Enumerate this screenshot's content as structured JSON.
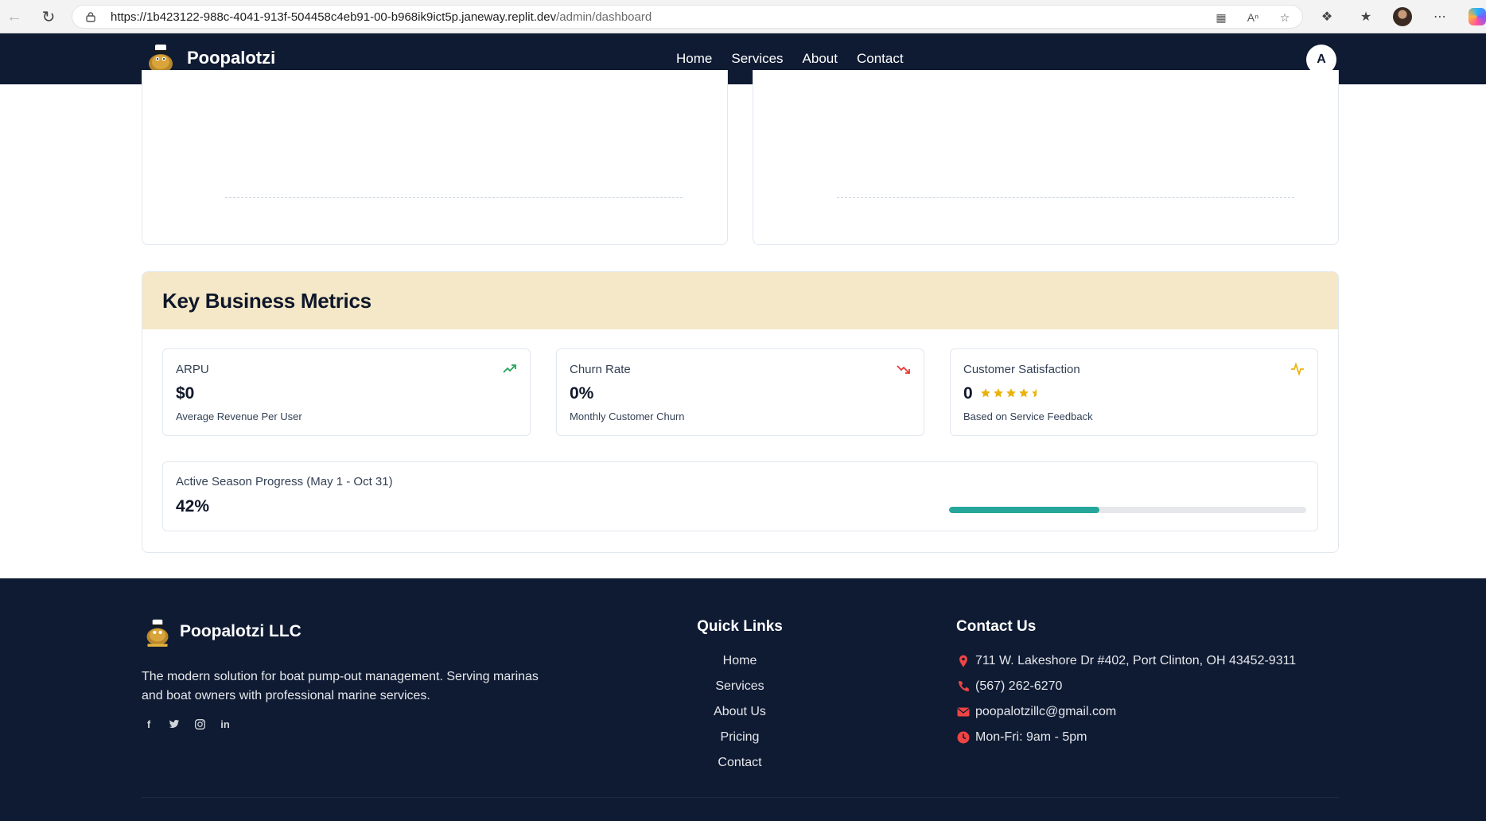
{
  "browser": {
    "url_host": "https://1b423122-988c-4041-913f-504458c4eb91-00-b968ik9ict5p.janeway.replit.dev",
    "url_path": "/admin/dashboard"
  },
  "header": {
    "brand": "Poopalotzi",
    "nav": [
      "Home",
      "Services",
      "About",
      "Contact"
    ],
    "avatar_initial": "A"
  },
  "metrics": {
    "title": "Key Business Metrics",
    "cards": [
      {
        "label": "ARPU",
        "value": "$0",
        "desc": "Average Revenue Per User",
        "icon": "trend-up-icon",
        "icon_color": "#22a55a"
      },
      {
        "label": "Churn Rate",
        "value": "0%",
        "desc": "Monthly Customer Churn",
        "icon": "trend-down-icon",
        "icon_color": "#e53935"
      },
      {
        "label": "Customer Satisfaction",
        "value": "0",
        "desc": "Based on Service Feedback",
        "icon": "activity-icon",
        "icon_color": "#eab308",
        "stars": 4.5
      }
    ],
    "progress": {
      "label": "Active Season Progress (May 1 - Oct 31)",
      "value": "42%",
      "fraction": 0.42,
      "color": "#26a69a"
    }
  },
  "footer": {
    "brand": "Poopalotzi LLC",
    "tagline": "The modern solution for boat pump-out management. Serving marinas and boat owners with professional marine services.",
    "socials": [
      "facebook-icon",
      "twitter-icon",
      "instagram-icon",
      "linkedin-icon"
    ],
    "quick_links_title": "Quick Links",
    "quick_links": [
      "Home",
      "Services",
      "About Us",
      "Pricing",
      "Contact"
    ],
    "contact_title": "Contact Us",
    "contact": {
      "address": "711 W. Lakeshore Dr #402, Port Clinton, OH 43452-9311",
      "phone": "(567) 262-6270",
      "email": "poopalotzillc@gmail.com",
      "hours": "Mon-Fri: 9am - 5pm"
    },
    "accent_color": "#ef4444"
  }
}
